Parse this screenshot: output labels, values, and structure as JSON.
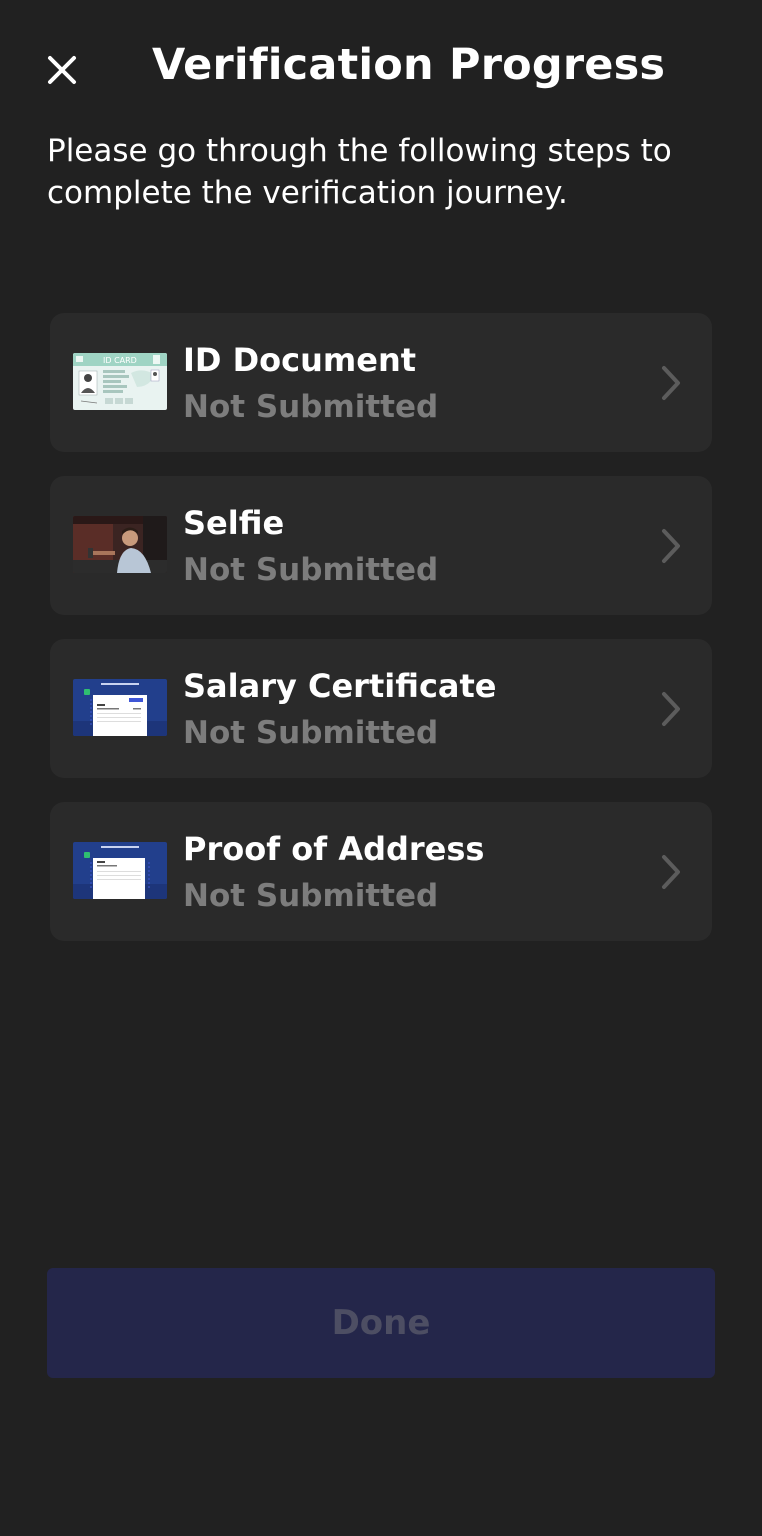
{
  "header": {
    "title": "Verification Progress",
    "close_icon": "close-icon"
  },
  "intro": "Please go through the following steps to complete the verification journey.",
  "steps": [
    {
      "label": "ID Document",
      "status": "Not Submitted",
      "thumbnail": "id-card-thumbnail"
    },
    {
      "label": "Selfie",
      "status": "Not Submitted",
      "thumbnail": "selfie-photo-thumbnail"
    },
    {
      "label": "Salary Certificate",
      "status": "Not Submitted",
      "thumbnail": "document-thumbnail"
    },
    {
      "label": "Proof of Address",
      "status": "Not Submitted",
      "thumbnail": "document-thumbnail"
    }
  ],
  "id_card_text": "ID CARD",
  "footer": {
    "done_label": "Done"
  },
  "colors": {
    "background": "#212121",
    "card": "#2a2a2a",
    "status_text": "#7d7d7d",
    "done_button_bg": "#24264a",
    "done_button_text": "#4d4e63"
  }
}
